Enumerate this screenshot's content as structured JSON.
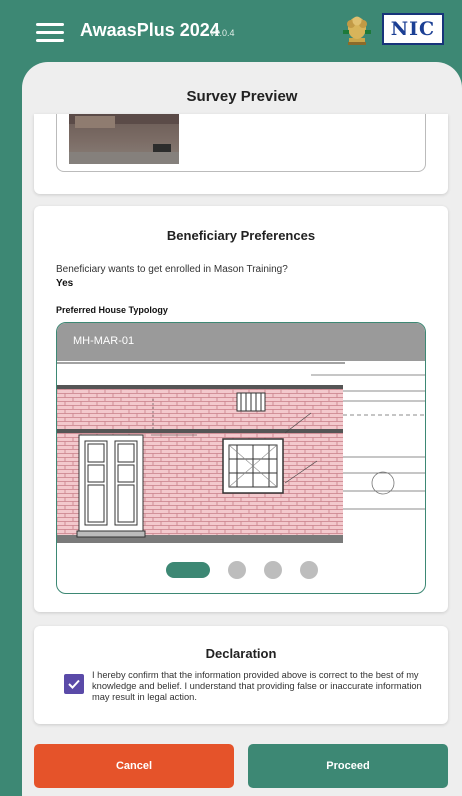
{
  "app": {
    "title": "AwaasPlus 2024",
    "version": "v2.0.4",
    "logo_text": "NIC"
  },
  "screen": {
    "title": "Survey Preview"
  },
  "beneficiary_preferences": {
    "title": "Beneficiary Preferences",
    "question": "Beneficiary wants to get enrolled in Mason Training?",
    "answer": "Yes",
    "typology_label": "Preferred House Typology",
    "carousel": {
      "items": [
        "MH-MAR-01"
      ],
      "page_count": 4,
      "active_index": 0
    }
  },
  "declaration": {
    "title": "Declaration",
    "checked": true,
    "text": "I hereby confirm that the information provided above is correct to the best of my knowledge and belief. I understand that providing false or inaccurate information may result in legal action."
  },
  "actions": {
    "cancel_label": "Cancel",
    "proceed_label": "Proceed"
  },
  "colors": {
    "primary": "#3d8874",
    "cancel": "#e5532a",
    "checkbox": "#5a4aa8"
  }
}
